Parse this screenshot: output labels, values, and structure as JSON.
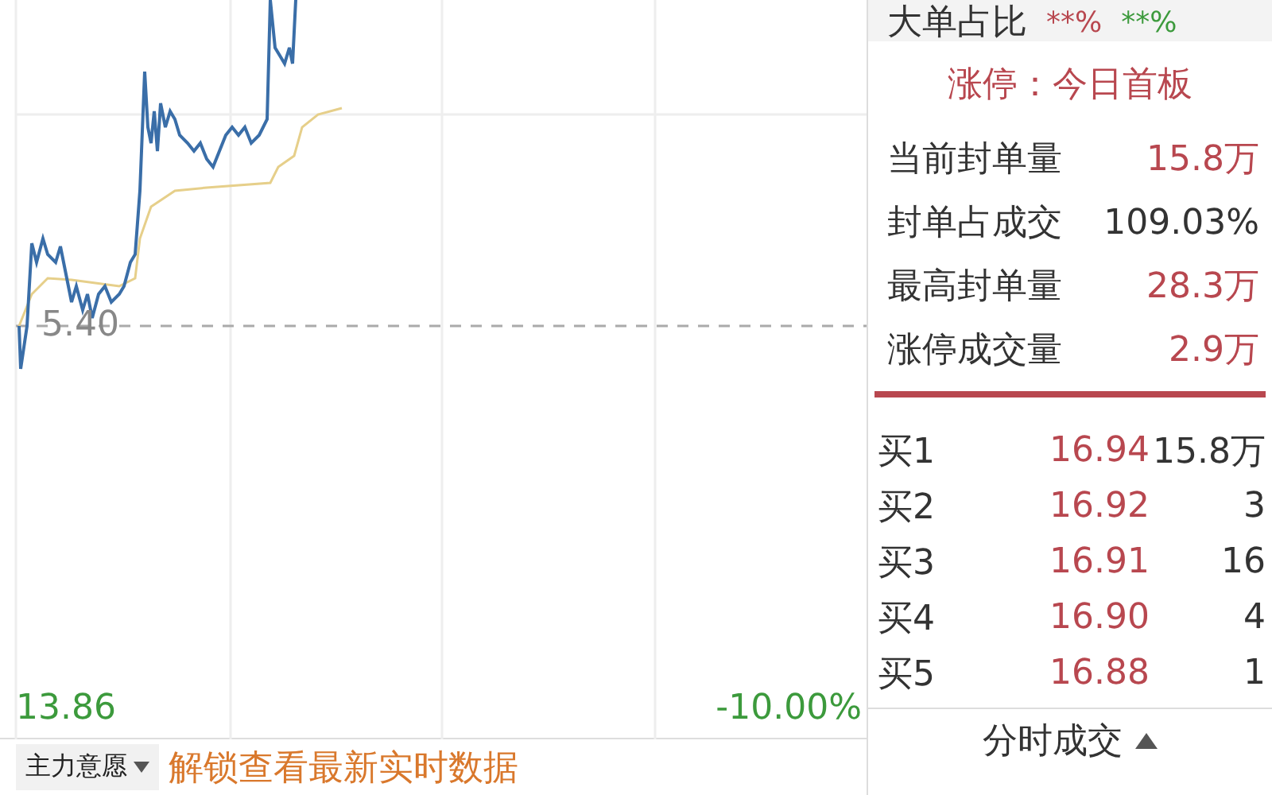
{
  "chart": {
    "price_marker": "5.40",
    "low_price": "13.86",
    "low_change": "-10.00%"
  },
  "bottom_bar": {
    "dropdown": "主力意愿",
    "unlock_link": "解锁查看最新实时数据"
  },
  "side": {
    "big_order": {
      "label": "大单占比",
      "buy": "**%",
      "sell": "**%"
    },
    "limit_status": "涨停：今日首板",
    "stats": [
      {
        "label": "当前封单量",
        "value": "15.8万",
        "color": "#b8474f"
      },
      {
        "label": "封单占成交",
        "value": "109.03%",
        "color": "#333333"
      },
      {
        "label": "最高封单量",
        "value": "28.3万",
        "color": "#b8474f"
      },
      {
        "label": "涨停成交量",
        "value": "2.9万",
        "color": "#b8474f"
      }
    ],
    "bids": [
      {
        "label": "买1",
        "price": "16.94",
        "volume": "15.8万"
      },
      {
        "label": "买2",
        "price": "16.92",
        "volume": "3"
      },
      {
        "label": "买3",
        "price": "16.91",
        "volume": "16"
      },
      {
        "label": "买4",
        "price": "16.90",
        "volume": "4"
      },
      {
        "label": "买5",
        "price": "16.88",
        "volume": "1"
      }
    ],
    "trades_header": "分时成交"
  }
}
